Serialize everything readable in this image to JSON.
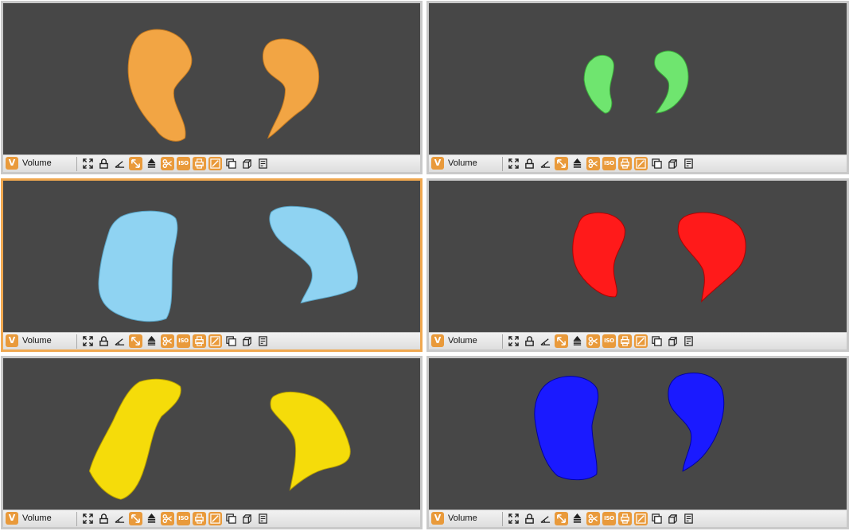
{
  "panels": [
    {
      "id": "p1",
      "label": "Volume",
      "color": "#f2a544",
      "active": false,
      "shape": "crescent-pair-1"
    },
    {
      "id": "p2",
      "label": "Volume",
      "color": "#6fe56f",
      "active": false,
      "shape": "crescent-pair-small"
    },
    {
      "id": "p3",
      "label": "Volume",
      "color": "#8fd3f2",
      "active": true,
      "shape": "block-pair"
    },
    {
      "id": "p4",
      "label": "Volume",
      "color": "#ff1a1a",
      "active": false,
      "shape": "crescent-pair-2"
    },
    {
      "id": "p5",
      "label": "Volume",
      "color": "#f5dc0a",
      "active": false,
      "shape": "slab-pair"
    },
    {
      "id": "p6",
      "label": "Volume",
      "color": "#1a1aff",
      "active": false,
      "shape": "crescent-pair-3"
    }
  ],
  "toolbar": {
    "badge": "V",
    "iso_label": "ISO",
    "tools": [
      {
        "name": "fit-view-icon",
        "orange": false
      },
      {
        "name": "lock-icon",
        "orange": false
      },
      {
        "name": "measure-angle-icon",
        "orange": false
      },
      {
        "name": "move-icon",
        "orange": true
      },
      {
        "name": "stack-icon",
        "orange": false
      },
      {
        "name": "scissors-icon",
        "orange": true
      },
      {
        "name": "iso-icon",
        "orange": true
      },
      {
        "name": "print-icon",
        "orange": true
      },
      {
        "name": "edit-icon",
        "orange": true
      },
      {
        "name": "window-icon",
        "orange": false
      },
      {
        "name": "cube-icon",
        "orange": false
      },
      {
        "name": "notes-icon",
        "orange": false
      }
    ]
  }
}
